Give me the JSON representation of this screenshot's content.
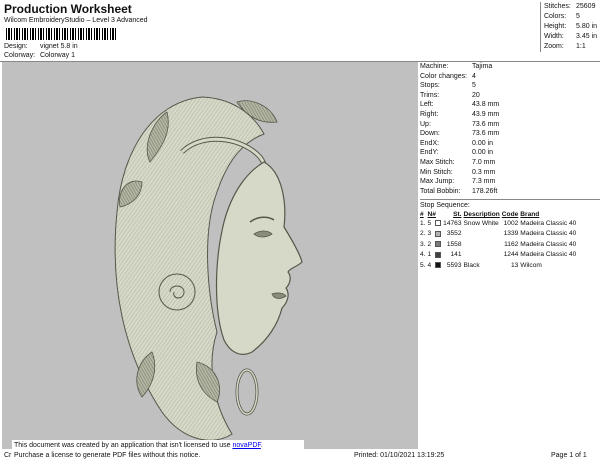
{
  "header": {
    "title": "Production Worksheet",
    "subtitle": "Wilcom EmbroideryStudio – Level 3 Advanced",
    "design_label": "Design:",
    "design_value": "vignet 5.8 in",
    "colorway_label": "Colorway:",
    "colorway_value": "Colorway 1"
  },
  "stats": [
    {
      "k": "Stitches:",
      "v": "25609"
    },
    {
      "k": "Colors:",
      "v": "5"
    },
    {
      "k": "Height:",
      "v": "5.80 in"
    },
    {
      "k": "Width:",
      "v": "3.45 in"
    },
    {
      "k": "Zoom:",
      "v": "1:1"
    }
  ],
  "machine_info": [
    {
      "k": "Machine:",
      "v": "Tajima"
    },
    {
      "k": "Color changes:",
      "v": "4"
    },
    {
      "k": "Stops:",
      "v": "5"
    },
    {
      "k": "Trims:",
      "v": "20"
    },
    {
      "k": "Left:",
      "v": "43.8 mm"
    },
    {
      "k": "Right:",
      "v": "43.9 mm"
    },
    {
      "k": "Up:",
      "v": "73.6 mm"
    },
    {
      "k": "Down:",
      "v": "73.6 mm"
    },
    {
      "k": "EndX:",
      "v": "0.00 in"
    },
    {
      "k": "EndY:",
      "v": "0.00 in"
    },
    {
      "k": "Max Stitch:",
      "v": "7.0 mm"
    },
    {
      "k": "Min Stitch:",
      "v": "0.3 mm"
    },
    {
      "k": "Max Jump:",
      "v": "7.3 mm"
    },
    {
      "k": "Total Bobbin:",
      "v": "178.26ft"
    }
  ],
  "stop_sequence": {
    "title": "Stop Sequence:",
    "columns": [
      "#",
      "N#",
      "St.",
      "Description",
      "Code",
      "Brand"
    ],
    "rows": [
      {
        "idx": "1.",
        "n": "5",
        "color": "#ffffff",
        "st": "14763",
        "desc": "Snow White",
        "code": "1002",
        "brand": "Madeira Classic 40"
      },
      {
        "idx": "2.",
        "n": "3",
        "color": "#b4b4b4",
        "st": "3552",
        "desc": "",
        "code": "1339",
        "brand": "Madeira Classic 40"
      },
      {
        "idx": "3.",
        "n": "2",
        "color": "#7a7a7a",
        "st": "1558",
        "desc": "",
        "code": "1162",
        "brand": "Madeira Classic 40"
      },
      {
        "idx": "4.",
        "n": "1",
        "color": "#404040",
        "st": "141",
        "desc": "",
        "code": "1244",
        "brand": "Madeira Classic 40"
      },
      {
        "idx": "5.",
        "n": "4",
        "color": "#111111",
        "st": "5593",
        "desc": "Black",
        "code": "13",
        "brand": "Wilcom"
      }
    ]
  },
  "notice": {
    "line1_pre": "This document was created by an application that isn't licensed to use ",
    "link": "novaPDF",
    "line1_post": ".",
    "line2": "Purchase a license to generate PDF files without this notice."
  },
  "footer": {
    "left": "Cr",
    "printed": "Printed: 01/10/2021 13:19:25",
    "page": "Page 1 of 1"
  }
}
